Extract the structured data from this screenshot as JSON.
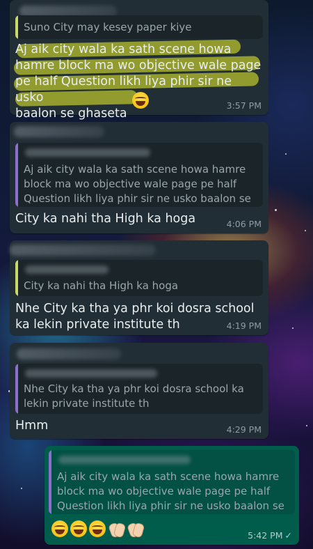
{
  "messages": [
    {
      "quote": "Suno City may kesey paper kiye",
      "text": "Aj aik city wala ka sath scene howa\nhamre block ma wo objective wale page\npe half Question likh liya phir sir ne usko\nbaalon se ghaseta",
      "time": "3:57 PM"
    },
    {
      "quote": "Aj aik city wala ka sath scene howa hamre\nblock ma wo objective wale page pe half\nQuestion likh liya phir sir ne usko baalon se ...",
      "text": "City ka nahi tha High ka hoga",
      "time": "4:06 PM"
    },
    {
      "quote": "City ka nahi tha High ka hoga",
      "text": "Nhe City ka tha ya phr koi dosra school\nka lekin private institute th",
      "time": "4:19 PM"
    },
    {
      "quote": "Nhe City ka tha ya phr koi dosra school ka\nlekin private institute th",
      "text": "Hmm",
      "time": "4:29 PM"
    },
    {
      "quote": "Aj aik city wala ka sath scene howa hamre\nblock ma wo objective wale page pe half\nQuestion likh liya phir sir ne usko baalon se ...",
      "time": "5:42 PM",
      "status": "✓"
    }
  ],
  "colors": {
    "incoming_bubble": "#222e35",
    "outgoing_bubble": "#005c4b",
    "highlight": "#d6de28"
  },
  "icons": [
    "grinning-sweat-emoji",
    "tears-of-joy-emoji",
    "clapping-hands-emoji",
    "read-tick-icon"
  ]
}
